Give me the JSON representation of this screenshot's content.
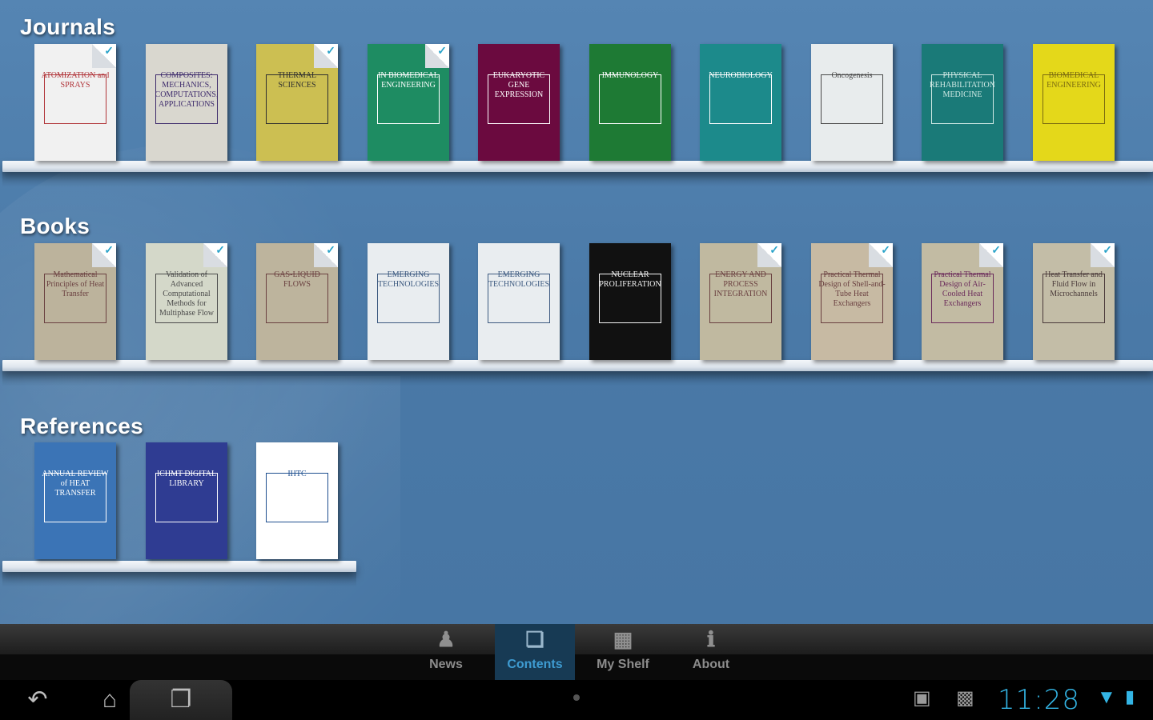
{
  "sections": {
    "journals": "Journals",
    "books": "Books",
    "references": "References"
  },
  "journals": [
    {
      "title": "ATOMIZATION and SPRAYS",
      "bg": "#f1f1f1",
      "fg": "#b1353a",
      "checked": true
    },
    {
      "title": "COMPOSITES: MECHANICS, COMPUTATIONS, APPLICATIONS",
      "bg": "#d9d7cf",
      "fg": "#3d2a6b",
      "checked": false
    },
    {
      "title": "THERMAL SCIENCES",
      "bg": "#ccbf52",
      "fg": "#2f2f2f",
      "checked": true
    },
    {
      "title": "IN BIOMEDICAL ENGINEERING",
      "bg": "#1e8c62",
      "fg": "#ffffff",
      "checked": true
    },
    {
      "title": "EUKARYOTIC GENE EXPRESSION",
      "bg": "#6b0a3f",
      "fg": "#ffffff",
      "checked": false
    },
    {
      "title": "IMMUNOLOGY",
      "bg": "#1e7a34",
      "fg": "#ffffff",
      "checked": false
    },
    {
      "title": "NEUROBIOLOGY",
      "bg": "#1c8a8b",
      "fg": "#ffffff",
      "checked": false
    },
    {
      "title": "Oncogenesis",
      "bg": "#e8eced",
      "fg": "#4a4a4a",
      "checked": false
    },
    {
      "title": "PHYSICAL REHABILITATION MEDICINE",
      "bg": "#1a7a78",
      "fg": "#cfe9e4",
      "checked": false
    },
    {
      "title": "BIOMEDICAL ENGINEERING",
      "bg": "#e4d81a",
      "fg": "#7a6a10",
      "checked": false
    }
  ],
  "books": [
    {
      "title": "Mathematical Principles of Heat Transfer",
      "bg": "#bcb39c",
      "fg": "#6a4040",
      "checked": true
    },
    {
      "title": "Validation of Advanced Computational Methods for Multiphase Flow",
      "bg": "#d4d8c9",
      "fg": "#4a4a4a",
      "checked": true
    },
    {
      "title": "GAS-LIQUID FLOWS",
      "bg": "#bdb49d",
      "fg": "#6a4040",
      "checked": true
    },
    {
      "title": "EMERGING TECHNOLOGIES",
      "bg": "#e9edf0",
      "fg": "#3d5a80",
      "checked": false
    },
    {
      "title": "EMERGING TECHNOLOGIES",
      "bg": "#e9edf0",
      "fg": "#3d5a80",
      "checked": false
    },
    {
      "title": "NUCLEAR PROLIFERATION",
      "bg": "#111111",
      "fg": "#f5f5f5",
      "checked": false
    },
    {
      "title": "ENERGY AND PROCESS INTEGRATION",
      "bg": "#c0b9a0",
      "fg": "#6a4040",
      "checked": true
    },
    {
      "title": "Practical Thermal Design of Shell-and-Tube Heat Exchangers",
      "bg": "#c7baa3",
      "fg": "#6a4040",
      "checked": true
    },
    {
      "title": "Practical Thermal Design of Air-Cooled Heat Exchangers",
      "bg": "#c2bba3",
      "fg": "#6a2a5a",
      "checked": true
    },
    {
      "title": "Heat Transfer and Fluid Flow in Microchannels",
      "bg": "#c3bda7",
      "fg": "#4a3a3a",
      "checked": true
    }
  ],
  "references": [
    {
      "title": "ANNUAL REVIEW of HEAT TRANSFER",
      "bg": "#3b74b6",
      "fg": "#ffffff",
      "checked": false
    },
    {
      "title": "ICHMT DIGITAL LIBRARY",
      "bg": "#2f3c92",
      "fg": "#ffffff",
      "checked": false
    },
    {
      "title": "IHTC",
      "bg": "#ffffff",
      "fg": "#1e4f8f",
      "checked": false
    }
  ],
  "tabs": [
    {
      "label": "News",
      "icon": "news-icon"
    },
    {
      "label": "Contents",
      "icon": "contents-icon"
    },
    {
      "label": "My Shelf",
      "icon": "shelf-icon"
    },
    {
      "label": "About",
      "icon": "about-icon"
    }
  ],
  "active_tab": "Contents",
  "status": {
    "time": "11:28"
  }
}
